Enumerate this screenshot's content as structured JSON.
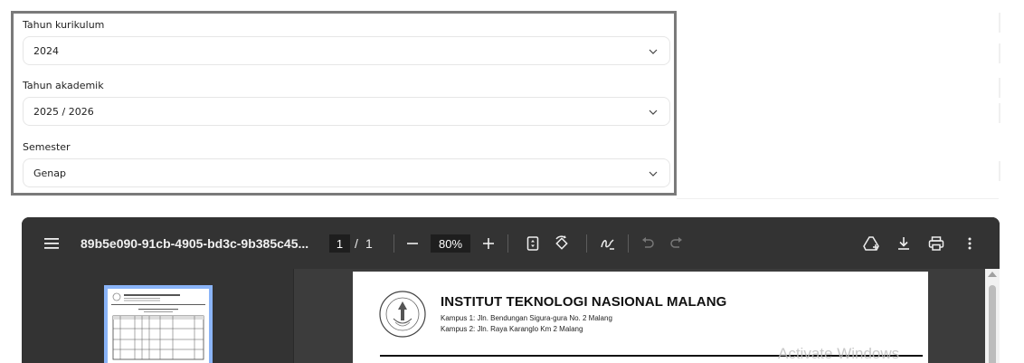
{
  "form": {
    "fields": [
      {
        "label": "Tahun kurikulum",
        "value": "2024"
      },
      {
        "label": "Tahun akademik",
        "value": "2025 / 2026"
      },
      {
        "label": "Semester",
        "value": "Genap"
      }
    ]
  },
  "viewer": {
    "file_name": "89b5e090-91cb-4905-bd3c-9b385c45...",
    "current_page": "1",
    "page_separator": "/",
    "total_pages": "1",
    "zoom": "80%",
    "colors": {
      "toolbar": "#333333",
      "background": "#3c3c3c",
      "thumb_border": "#8ab4f8"
    }
  },
  "document": {
    "institution": "INSTITUT TEKNOLOGI NASIONAL MALANG",
    "campus1": "Kampus 1: Jln. Bendungan Sigura-gura No. 2 Malang",
    "campus2": "Kampus 2: Jln. Raya Karanglo Km 2 Malang"
  },
  "watermark": "Activate Windows"
}
